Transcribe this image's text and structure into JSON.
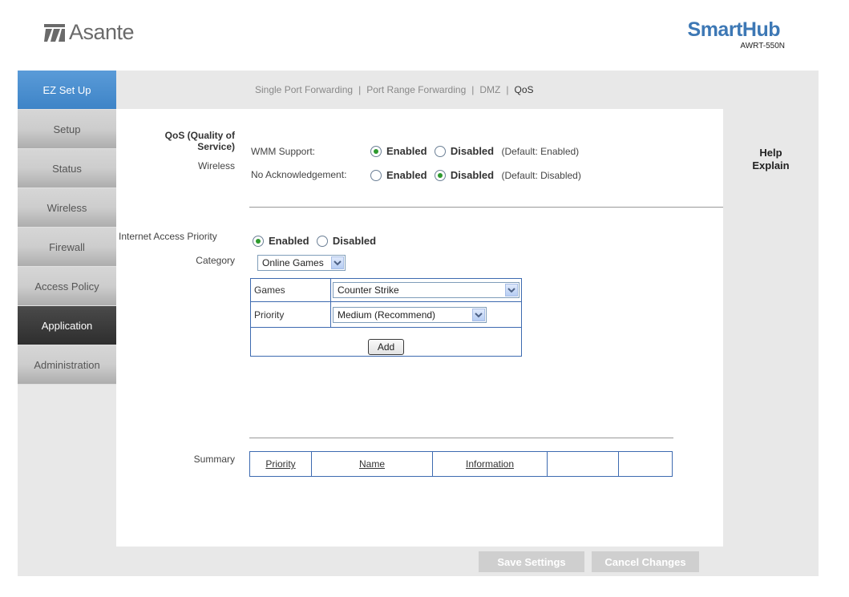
{
  "header": {
    "brand": "Asante",
    "product": "SmartHub",
    "model": "AWRT-550N"
  },
  "sidebar": {
    "items": [
      {
        "label": "EZ Set Up"
      },
      {
        "label": "Setup"
      },
      {
        "label": "Status"
      },
      {
        "label": "Wireless"
      },
      {
        "label": "Firewall"
      },
      {
        "label": "Access Policy"
      },
      {
        "label": "Application"
      },
      {
        "label": "Administration"
      }
    ],
    "active": "Application"
  },
  "subnav": {
    "items": [
      "Single Port Forwarding",
      "Port Range Forwarding",
      "DMZ",
      "QoS"
    ],
    "current": "QoS"
  },
  "qos": {
    "section_label_line1": "QoS (Quality of",
    "section_label_line2": "Service)",
    "wireless_label": "Wireless",
    "wmm": {
      "label": "WMM Support:",
      "enabled": "Enabled",
      "disabled": "Disabled",
      "default": "(Default: Enabled)",
      "selected": "enabled"
    },
    "noack": {
      "label": "No Acknowledgement:",
      "enabled": "Enabled",
      "disabled": "Disabled",
      "default": "(Default: Disabled)",
      "selected": "disabled"
    }
  },
  "internet_priority": {
    "label": "Internet Access Priority",
    "enabled": "Enabled",
    "disabled": "Disabled",
    "selected": "enabled",
    "category_label": "Category",
    "category_value": "Online Games",
    "games_label": "Games",
    "games_value": "Counter Strike",
    "priority_label": "Priority",
    "priority_value": "Medium (Recommend)",
    "add_label": "Add"
  },
  "summary": {
    "label": "Summary",
    "columns": [
      "Priority",
      "Name",
      "Information"
    ]
  },
  "help": {
    "line1": "Help",
    "line2": "Explain"
  },
  "footer": {
    "save": "Save Settings",
    "cancel": "Cancel Changes"
  },
  "colors": {
    "brand_blue": "#3d78b5",
    "ez_setup": "#4a8fd1",
    "active_nav": "#3a3a3a",
    "radio_checked": "#2e9a2e",
    "table_border": "#3d6ab0"
  }
}
